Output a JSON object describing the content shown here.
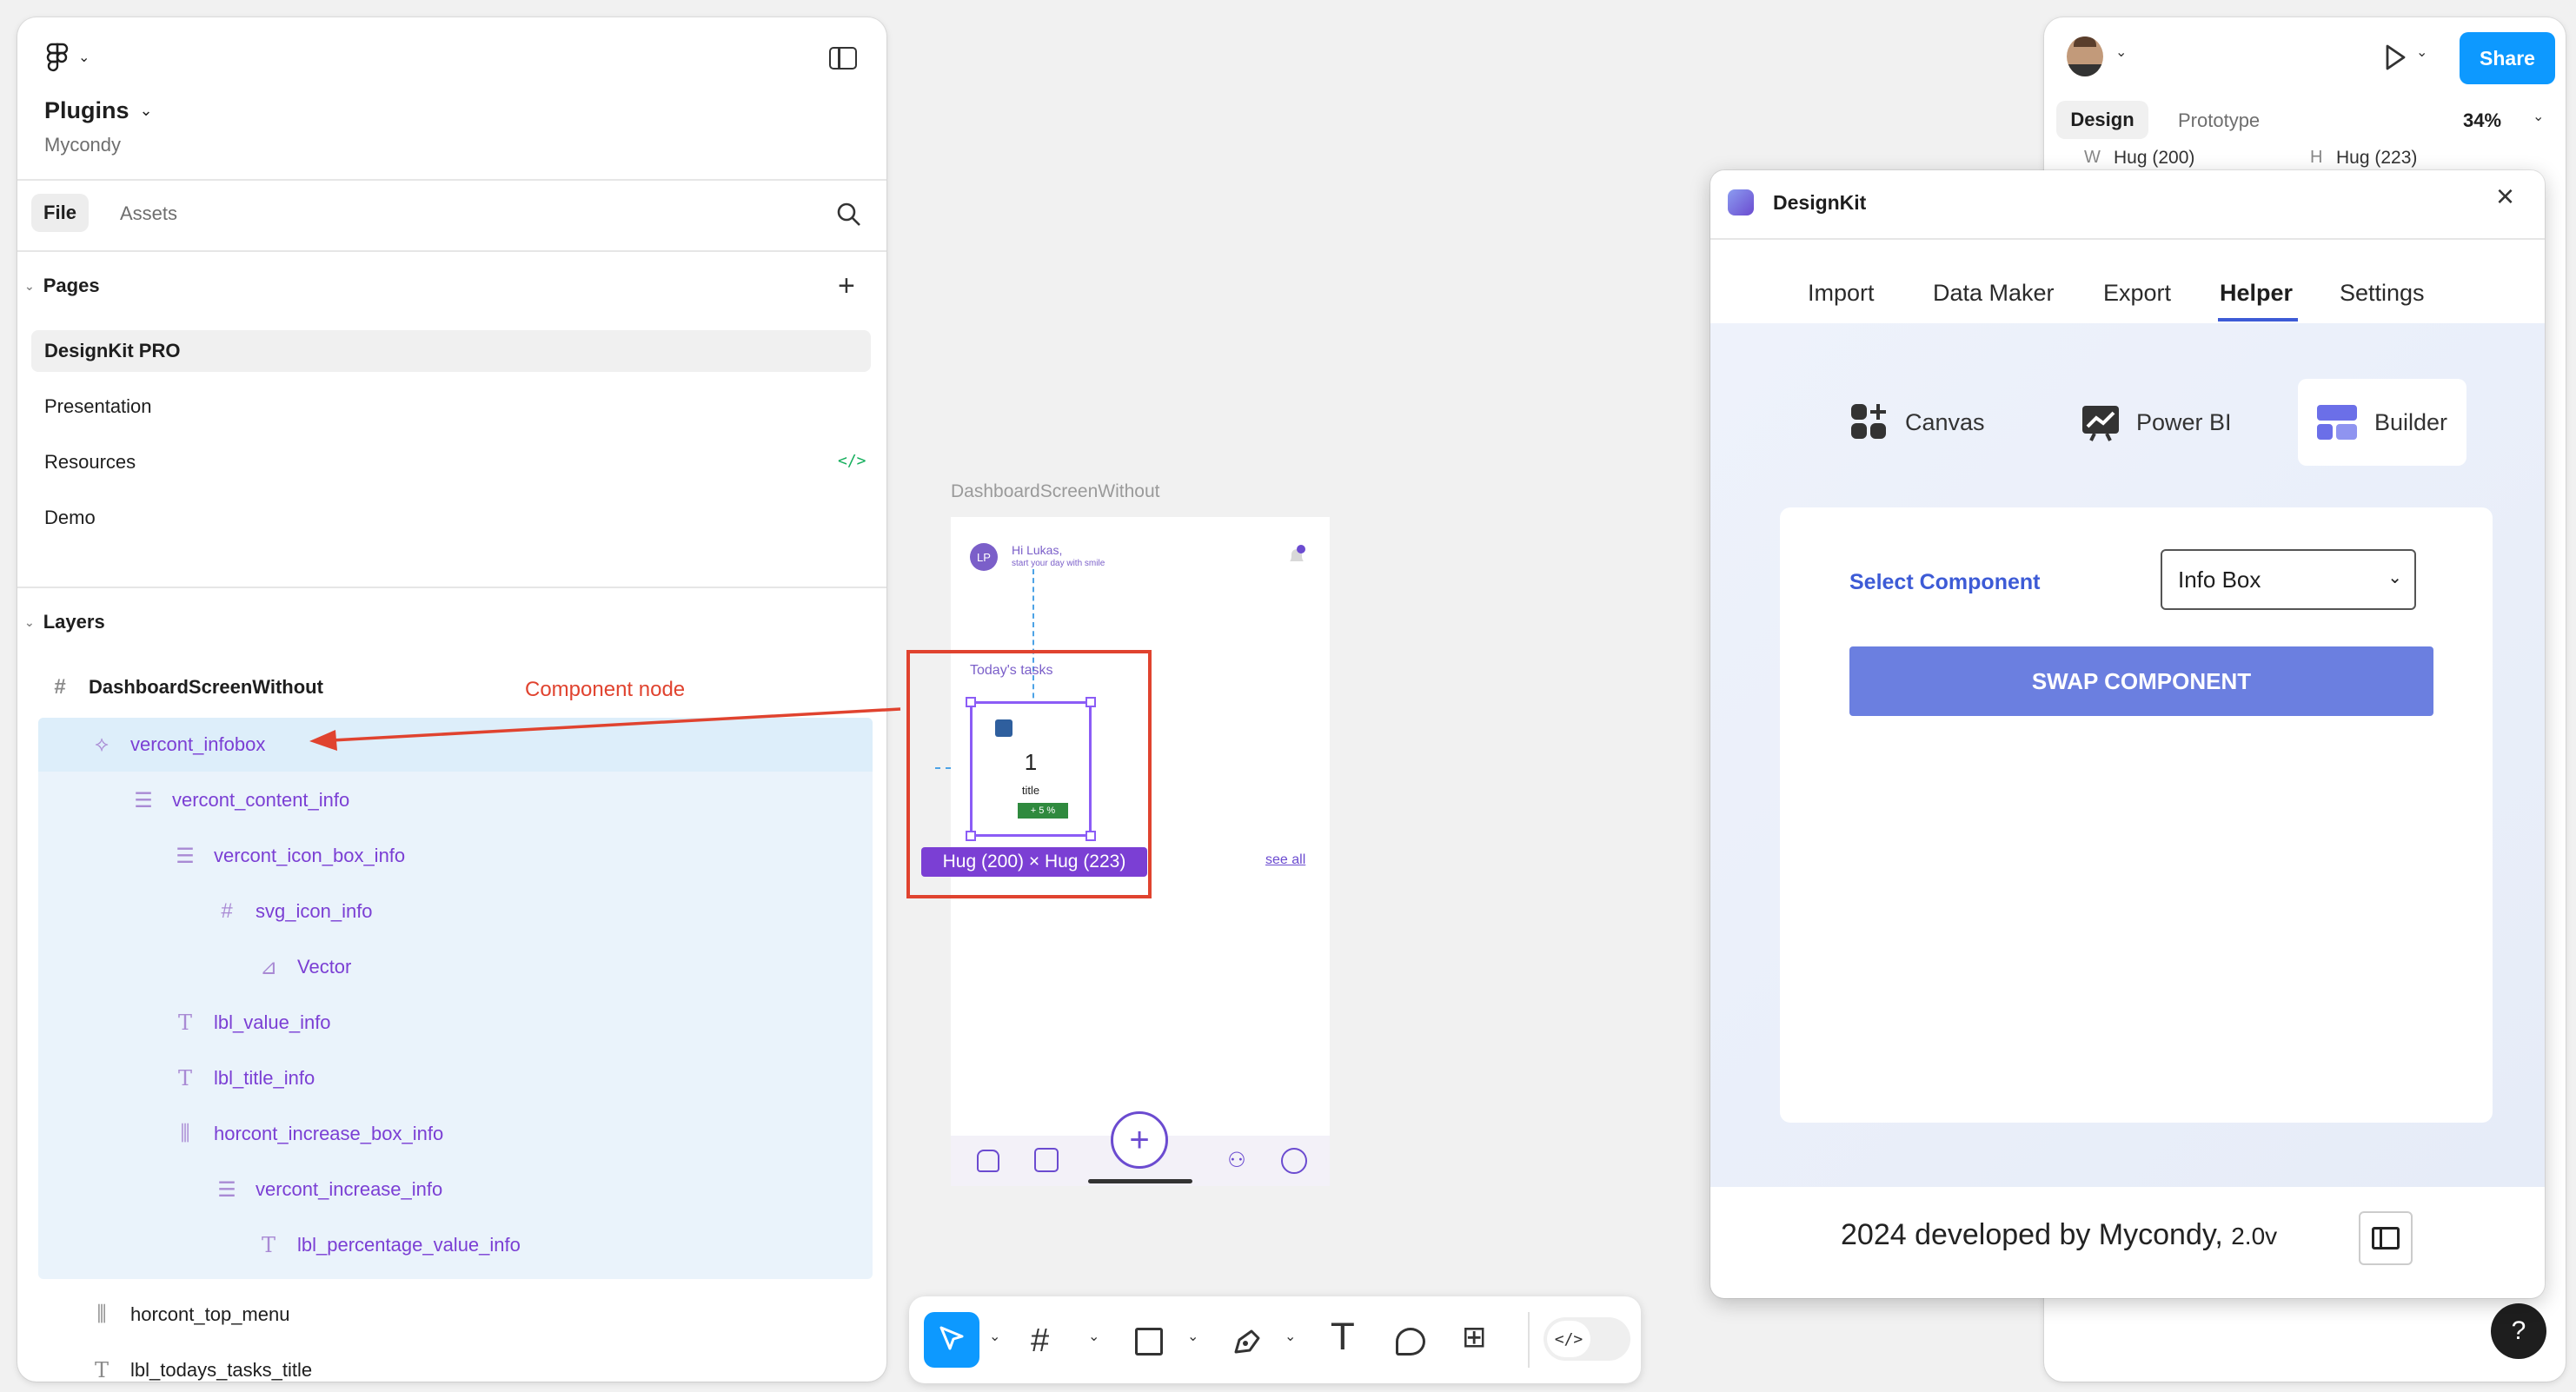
{
  "left_panel": {
    "file_name": "Plugins",
    "team_name": "Mycondy",
    "tabs": [
      "File",
      "Assets"
    ],
    "pages_title": "Pages",
    "pages": [
      "DesignKit PRO",
      "Presentation",
      "Resources",
      "Demo"
    ],
    "layers_title": "Layers",
    "root_frame": "DashboardScreenWithout",
    "layers": [
      {
        "name": "vercont_infobox",
        "icon": "component-icon"
      },
      {
        "name": "vercont_content_info",
        "icon": "vertical-stack-icon"
      },
      {
        "name": "vercont_icon_box_info",
        "icon": "vertical-stack-icon"
      },
      {
        "name": "svg_icon_info",
        "icon": "frame-icon"
      },
      {
        "name": "Vector",
        "icon": "vector-icon"
      },
      {
        "name": "lbl_value_info",
        "icon": "text-icon"
      },
      {
        "name": "lbl_title_info",
        "icon": "text-icon"
      },
      {
        "name": "horcont_increase_box_info",
        "icon": "horizontal-stack-icon"
      },
      {
        "name": "vercont_increase_info",
        "icon": "vertical-stack-icon"
      },
      {
        "name": "lbl_percentage_value_info",
        "icon": "text-icon"
      },
      {
        "name": "horcont_top_menu",
        "icon": "horizontal-stack-icon"
      },
      {
        "name": "lbl_todays_tasks_title",
        "icon": "text-icon"
      }
    ]
  },
  "annotation": {
    "label": "Component node",
    "color": "#e0432f"
  },
  "canvas": {
    "frame_label": "DashboardScreenWithout",
    "greeting": "Hi Lukas,",
    "greeting_sub": "start your day with smile",
    "avatar_initials": "LP",
    "section_title": "Today's tasks",
    "see_all": "see all",
    "card_value": "1",
    "card_title": "title",
    "card_badge": "+ 5 %",
    "size_badge": "Hug (200) × Hug (223)"
  },
  "right_panel": {
    "share_label": "Share",
    "tabs": [
      "Design",
      "Prototype"
    ],
    "zoom": "34%",
    "w_label": "W",
    "w_value": "Hug (200)",
    "h_label": "H",
    "h_value": "Hug (223)"
  },
  "plugin": {
    "title": "DesignKit",
    "tabs": [
      "Import",
      "Data Maker",
      "Export",
      "Helper",
      "Settings"
    ],
    "active_tab": "Helper",
    "modes": [
      "Canvas",
      "Power BI",
      "Builder"
    ],
    "select_label": "Select Component",
    "select_value": "Info Box",
    "swap_button": "SWAP COMPONENT",
    "footer_text": "2024 developed by Mycondy,",
    "footer_version": "2.0v"
  },
  "colors": {
    "accent_purple": "#7b3fd4",
    "figma_blue": "#0d99ff",
    "plugin_button": "#6b7fe0",
    "select_label": "#3d5bd6"
  }
}
